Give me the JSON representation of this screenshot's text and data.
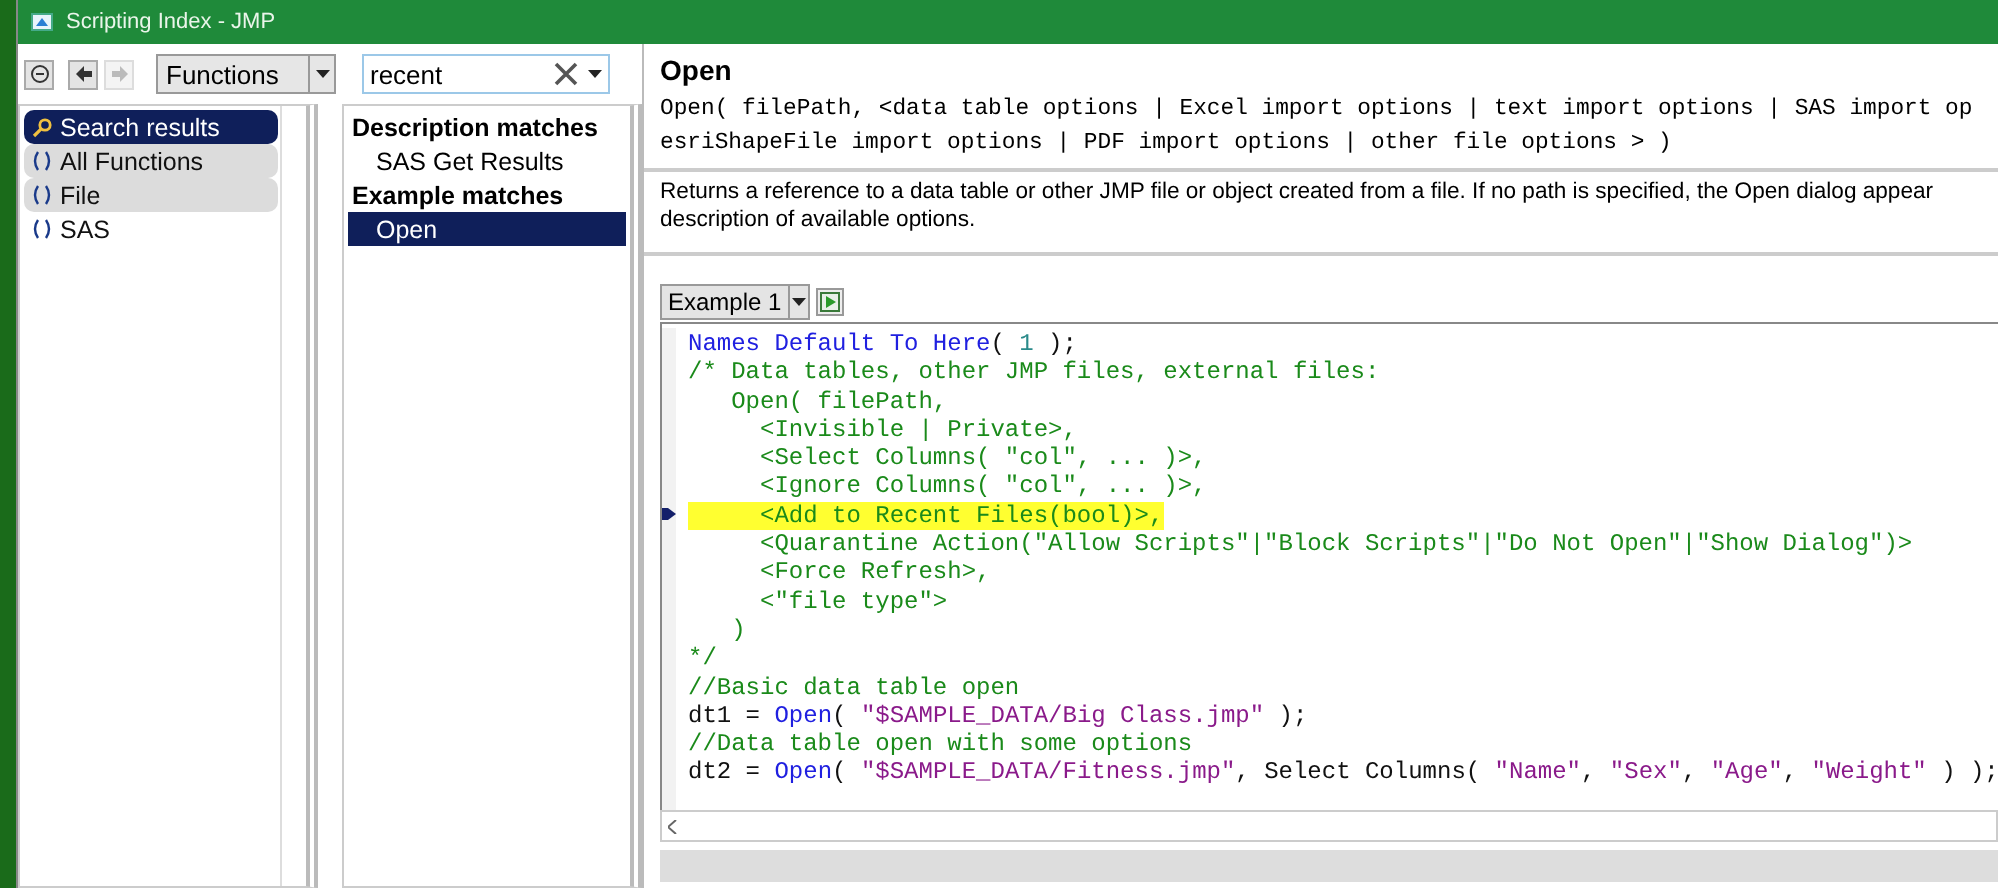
{
  "window": {
    "title": "Scripting Index - JMP"
  },
  "toolbar": {
    "category": "Functions",
    "search": {
      "value": "recent"
    }
  },
  "sidebar": {
    "items": [
      {
        "label": "Search results",
        "kind": "search",
        "selected": true,
        "highlighted": false
      },
      {
        "label": "All Functions",
        "kind": "function",
        "selected": false,
        "highlighted": true
      },
      {
        "label": "File",
        "kind": "function",
        "selected": false,
        "highlighted": true
      },
      {
        "label": "SAS",
        "kind": "function",
        "selected": false,
        "highlighted": false
      }
    ]
  },
  "results": {
    "items": [
      {
        "label": "Description matches",
        "kind": "heading",
        "selected": false
      },
      {
        "label": "SAS Get Results",
        "kind": "item",
        "selected": false
      },
      {
        "label": "Example matches",
        "kind": "heading",
        "selected": false
      },
      {
        "label": "Open",
        "kind": "item",
        "selected": true
      }
    ]
  },
  "detail": {
    "title": "Open",
    "signature": [
      "Open( filePath, <data table options | Excel import options | text import options | SAS import op",
      "esriShapeFile import options | PDF import options | other file options > )"
    ],
    "description": "Returns a reference to a data table or other JMP file or object created from a file. If no path is specified, the Open dialog appear",
    "description_2": "description of available options.",
    "example": {
      "label": "Example 1",
      "lines": [
        {
          "highlighted": false,
          "marker": false,
          "tokens": [
            {
              "kind": "keyword",
              "text": "Names Default To Here"
            },
            {
              "kind": "plain",
              "text": "( "
            },
            {
              "kind": "number",
              "text": "1"
            },
            {
              "kind": "plain",
              "text": " );"
            }
          ]
        },
        {
          "highlighted": false,
          "marker": false,
          "tokens": [
            {
              "kind": "comment",
              "text": "/* Data tables, other JMP files, external files:"
            }
          ]
        },
        {
          "highlighted": false,
          "marker": false,
          "tokens": [
            {
              "kind": "comment",
              "text": "   Open( filePath,"
            }
          ]
        },
        {
          "highlighted": false,
          "marker": false,
          "tokens": [
            {
              "kind": "comment",
              "text": "     <Invisible | Private>,"
            }
          ]
        },
        {
          "highlighted": false,
          "marker": false,
          "tokens": [
            {
              "kind": "comment",
              "text": "     <Select Columns( \"col\", ... )>,"
            }
          ]
        },
        {
          "highlighted": false,
          "marker": false,
          "tokens": [
            {
              "kind": "comment",
              "text": "     <Ignore Columns( \"col\", ... )>,"
            }
          ]
        },
        {
          "highlighted": true,
          "marker": true,
          "tokens": [
            {
              "kind": "comment",
              "text": "     <Add to Recent Files(bool)>,"
            }
          ]
        },
        {
          "highlighted": false,
          "marker": false,
          "tokens": [
            {
              "kind": "comment",
              "text": "     <Quarantine Action(\"Allow Scripts\"|\"Block Scripts\"|\"Do Not Open\"|\"Show Dialog\")>"
            }
          ]
        },
        {
          "highlighted": false,
          "marker": false,
          "tokens": [
            {
              "kind": "comment",
              "text": "     <Force Refresh>,"
            }
          ]
        },
        {
          "highlighted": false,
          "marker": false,
          "tokens": [
            {
              "kind": "comment",
              "text": "     <\"file type\">"
            }
          ]
        },
        {
          "highlighted": false,
          "marker": false,
          "tokens": [
            {
              "kind": "comment",
              "text": "   )"
            }
          ]
        },
        {
          "highlighted": false,
          "marker": false,
          "tokens": [
            {
              "kind": "comment",
              "text": "*/"
            }
          ]
        },
        {
          "highlighted": false,
          "marker": false,
          "tokens": [
            {
              "kind": "comment",
              "text": "//Basic data table open"
            }
          ]
        },
        {
          "highlighted": false,
          "marker": false,
          "tokens": [
            {
              "kind": "plain",
              "text": "dt1 = "
            },
            {
              "kind": "keyword",
              "text": "Open"
            },
            {
              "kind": "plain",
              "text": "( "
            },
            {
              "kind": "string",
              "text": "\"$SAMPLE_DATA/Big Class.jmp\""
            },
            {
              "kind": "plain",
              "text": " );"
            }
          ]
        },
        {
          "highlighted": false,
          "marker": false,
          "tokens": [
            {
              "kind": "comment",
              "text": "//Data table open with some options"
            }
          ]
        },
        {
          "highlighted": false,
          "marker": false,
          "tokens": [
            {
              "kind": "plain",
              "text": "dt2 = "
            },
            {
              "kind": "keyword",
              "text": "Open"
            },
            {
              "kind": "plain",
              "text": "( "
            },
            {
              "kind": "string",
              "text": "\"$SAMPLE_DATA/Fitness.jmp\""
            },
            {
              "kind": "plain",
              "text": ", Select Columns( "
            },
            {
              "kind": "string",
              "text": "\"Name\""
            },
            {
              "kind": "plain",
              "text": ", "
            },
            {
              "kind": "string",
              "text": "\"Sex\""
            },
            {
              "kind": "plain",
              "text": ", "
            },
            {
              "kind": "string",
              "text": "\"Age\""
            },
            {
              "kind": "plain",
              "text": ", "
            },
            {
              "kind": "string",
              "text": "\"Weight\""
            },
            {
              "kind": "plain",
              "text": " ) );"
            }
          ]
        }
      ]
    }
  }
}
